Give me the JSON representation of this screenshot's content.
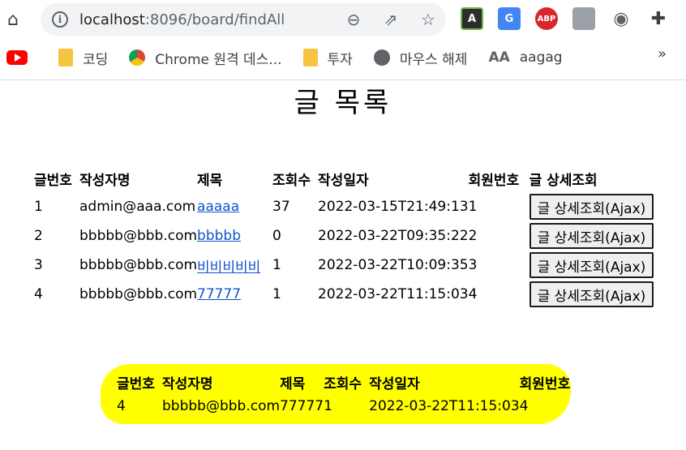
{
  "browser": {
    "url_host": "localhost",
    "url_path": ":8096/board/findAll",
    "back_icon": "home-icon",
    "extensions": [
      "A",
      "G",
      "ABP",
      "",
      "",
      ""
    ],
    "bookmarks": [
      {
        "label": "",
        "icon": "youtube-icon"
      },
      {
        "label": "코딩",
        "icon": "folder-icon"
      },
      {
        "label": "Chrome 원격 데스...",
        "icon": "chrome-icon"
      },
      {
        "label": "투자",
        "icon": "folder-icon"
      },
      {
        "label": "마우스 해제",
        "icon": "globe-icon"
      },
      {
        "label": "aagag",
        "icon": "aa-icon"
      }
    ],
    "more": "»"
  },
  "page": {
    "title": "글 목록",
    "columns": [
      "글번호",
      "작성자명",
      "제목",
      "조회수",
      "작성일자",
      "회원번호",
      "글 상세조회"
    ],
    "rows": [
      {
        "id": "1",
        "writer": "admin@aaa.com",
        "title": "aaaaa",
        "hits": "37",
        "date": "2022-03-15T21:49:13",
        "member": "1",
        "button": "글 상세조회(Ajax)"
      },
      {
        "id": "2",
        "writer": "bbbbb@bbb.com",
        "title": "bbbbb",
        "hits": "0",
        "date": "2022-03-22T09:35:22",
        "member": "2",
        "button": "글 상세조회(Ajax)"
      },
      {
        "id": "3",
        "writer": "bbbbb@bbb.com",
        "title": "비비비비비",
        "hits": "1",
        "date": "2022-03-22T10:09:35",
        "member": "3",
        "button": "글 상세조회(Ajax)"
      },
      {
        "id": "4",
        "writer": "bbbbb@bbb.com",
        "title": "77777",
        "hits": "1",
        "date": "2022-03-22T11:15:03",
        "member": "4",
        "button": "글 상세조회(Ajax)"
      }
    ],
    "detail": {
      "columns": [
        "글번호",
        "작성자명",
        "제목",
        "조회수",
        "작성일자",
        "회원번호"
      ],
      "row": {
        "id": "4",
        "writer": "bbbbb@bbb.com",
        "title": "77777",
        "hits": "1",
        "date": "2022-03-22T11:15:03",
        "member": "4"
      },
      "highlight_color": "#ffff00"
    }
  }
}
